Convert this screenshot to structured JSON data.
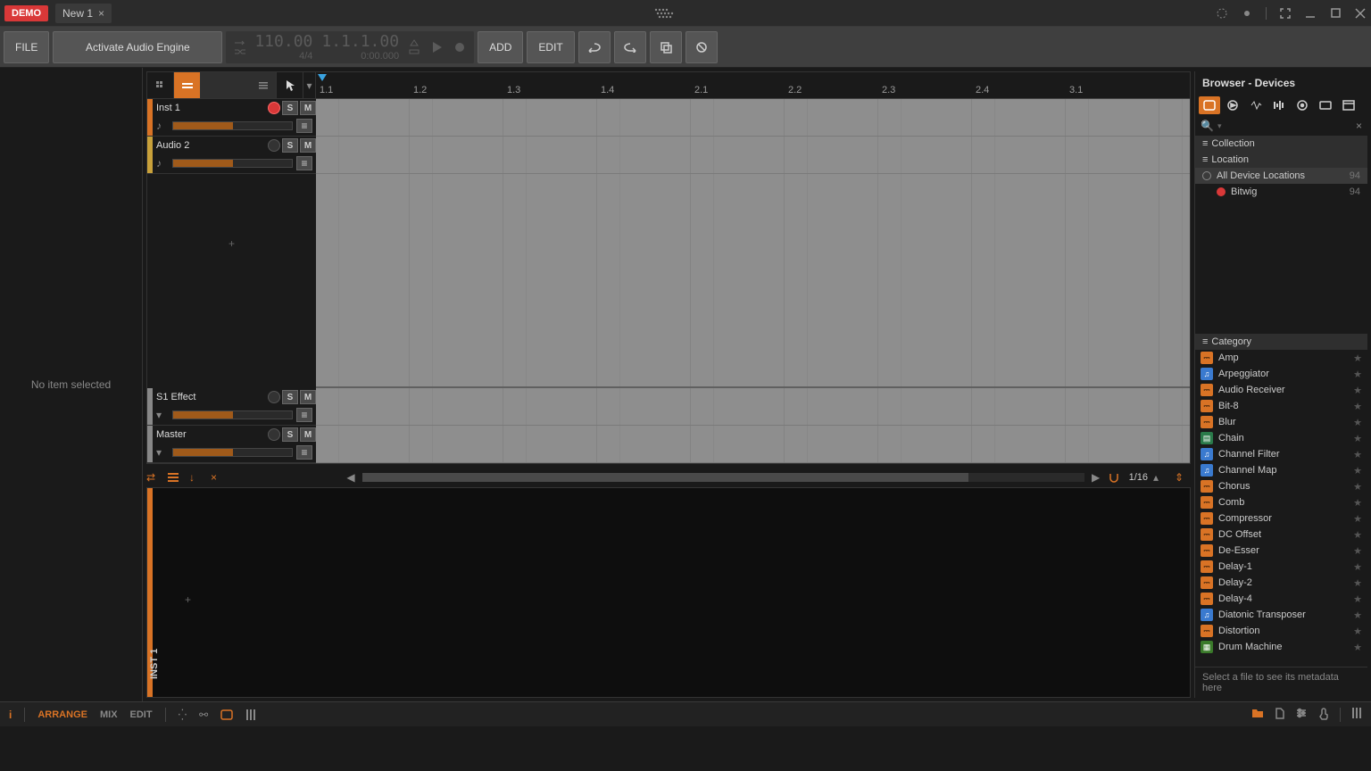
{
  "titlebar": {
    "demo": "DEMO",
    "tab": "New 1"
  },
  "toolbar": {
    "file": "FILE",
    "activate": "Activate Audio Engine",
    "tempo": "110.00",
    "timesig": "4/4",
    "position": "1.1.1.00",
    "time": "0:00.000",
    "add": "ADD",
    "edit": "EDIT"
  },
  "ruler": [
    "1.1",
    "1.2",
    "1.3",
    "1.4",
    "2.1",
    "2.2",
    "2.3",
    "2.4",
    "3.1"
  ],
  "tracks": [
    {
      "name": "Inst 1",
      "color": "#d97325",
      "rec": true
    },
    {
      "name": "Audio 2",
      "color": "#c9a13a",
      "rec": false
    }
  ],
  "busTracks": [
    {
      "name": "S1 Effect",
      "color": "#888"
    },
    {
      "name": "Master",
      "color": "#888"
    }
  ],
  "inspector": {
    "empty": "No item selected"
  },
  "scroll": {
    "grid": "1/16"
  },
  "detail": {
    "label": "INST 1"
  },
  "browser": {
    "title": "Browser - Devices",
    "sections": {
      "collection": "Collection",
      "location": "Location",
      "category": "Category"
    },
    "locations": [
      {
        "name": "All Device Locations",
        "count": 94,
        "sel": true
      },
      {
        "name": "Bitwig",
        "count": 94,
        "sel": false
      }
    ],
    "categories": [
      {
        "name": "Amp",
        "type": "fx"
      },
      {
        "name": "Arpeggiator",
        "type": "note"
      },
      {
        "name": "Audio Receiver",
        "type": "fx"
      },
      {
        "name": "Bit-8",
        "type": "fx"
      },
      {
        "name": "Blur",
        "type": "fx"
      },
      {
        "name": "Chain",
        "type": "cont"
      },
      {
        "name": "Channel Filter",
        "type": "note"
      },
      {
        "name": "Channel Map",
        "type": "note"
      },
      {
        "name": "Chorus",
        "type": "fx"
      },
      {
        "name": "Comb",
        "type": "fx"
      },
      {
        "name": "Compressor",
        "type": "fx"
      },
      {
        "name": "DC Offset",
        "type": "fx"
      },
      {
        "name": "De-Esser",
        "type": "fx"
      },
      {
        "name": "Delay-1",
        "type": "fx"
      },
      {
        "name": "Delay-2",
        "type": "fx"
      },
      {
        "name": "Delay-4",
        "type": "fx"
      },
      {
        "name": "Diatonic Transposer",
        "type": "note"
      },
      {
        "name": "Distortion",
        "type": "fx"
      },
      {
        "name": "Drum Machine",
        "type": "inst"
      }
    ],
    "footer": "Select a file to see its metadata here"
  },
  "footer": {
    "views": [
      "ARRANGE",
      "MIX",
      "EDIT"
    ]
  }
}
